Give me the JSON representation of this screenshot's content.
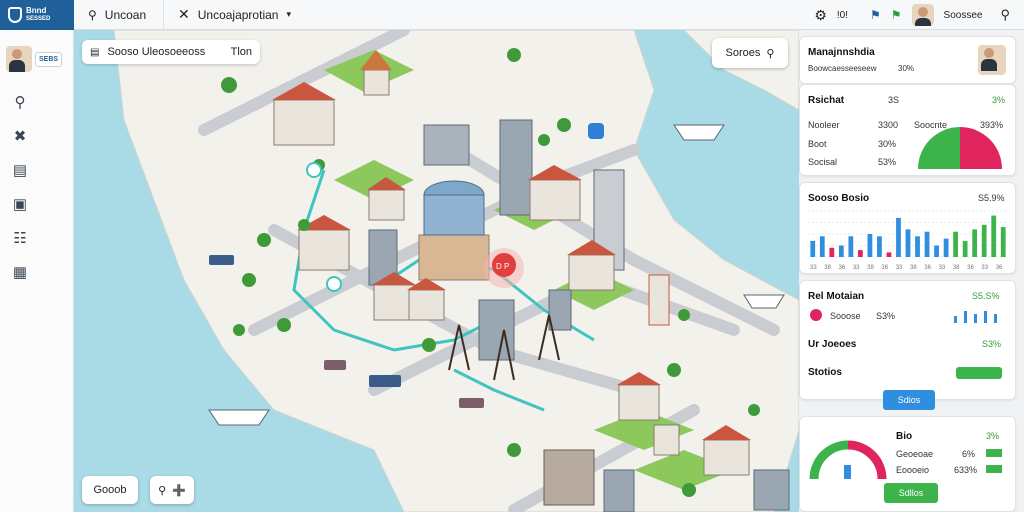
{
  "topbar": {
    "logo_line1": "Bnnd",
    "logo_line2": "SESSED",
    "search_label": "Uncoan",
    "location_label": "Uncoajaprotian",
    "count_value": "!0!",
    "user_name": "Soossee"
  },
  "sidebar": {
    "user_badge": "SEBS"
  },
  "map": {
    "search_text": "Sooso  Uleosoeeoss",
    "search_suffix": "Tlon",
    "search_button": "Soroes",
    "bottom_left_button": "Gooob",
    "pin_label": "D P"
  },
  "panel": {
    "header": {
      "title": "Manajnnshdia",
      "subtitle": "Boowcaesseeseew",
      "subtitle_value": "30%"
    },
    "stats": {
      "title": "Rsichat",
      "title_value": "3S",
      "title_pct": "3%",
      "rows": [
        {
          "label": "Nooleer",
          "value": "3300"
        },
        {
          "label": "Boot",
          "value": "30%"
        },
        {
          "label": "Socisal",
          "value": "53%"
        }
      ],
      "side_label": "Soocnte",
      "side_value": "393%",
      "gauge_green_pct": 50,
      "gauge_red_pct": 50
    },
    "bars": {
      "title": "Sooso Bosio",
      "value": "S5.9%",
      "series_blue": [
        0.35,
        0.45,
        0.25,
        0.45,
        0.5,
        0.45,
        0.85,
        0.6,
        0.45,
        0.55,
        0.25,
        0.4
      ],
      "series_green": [
        0.55,
        0.35,
        0.6,
        0.7,
        0.9,
        0.65
      ],
      "series_red": [
        0.2,
        0.15,
        0.1
      ],
      "tick_labels": [
        "33",
        "38",
        "36",
        "33",
        "38",
        "36",
        "33",
        "38",
        "36",
        "33",
        "38",
        "36",
        "33",
        "36"
      ]
    },
    "rel": {
      "title": "Rel Motaian",
      "value": "S5.S%",
      "row_label": "Sooose",
      "row_value": "S3%",
      "row2_label": "Ur Joeoes",
      "row2_value": "S3%",
      "row3_label": "Stotios",
      "button": "Sdios"
    },
    "bottom": {
      "title": "Bio",
      "value": "3%",
      "rows": [
        {
          "label": "Geoeoae",
          "value": "6%"
        },
        {
          "label": "Eoooeio",
          "value": "633%"
        }
      ],
      "button": "Sdllos"
    }
  },
  "colors": {
    "brand": "#1f5f9a",
    "water": "#a9dbe6",
    "land": "#f2f1ec",
    "grass": "#8cc85c",
    "green": "#3cb44b",
    "red": "#e0245e",
    "blue": "#2f8fde"
  }
}
